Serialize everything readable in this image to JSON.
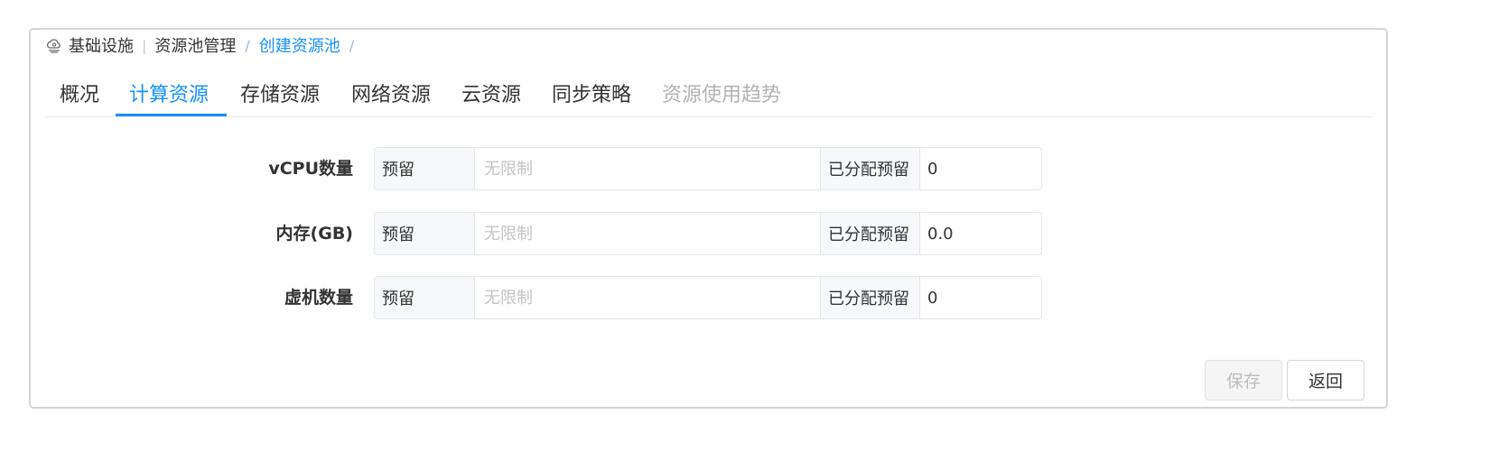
{
  "breadcrumb": {
    "icon": "cloud-icon",
    "items": [
      "基础设施",
      "资源池管理"
    ],
    "current": "创建资源池",
    "separator": "/"
  },
  "tabs": [
    {
      "label": "概况",
      "state": "normal"
    },
    {
      "label": "计算资源",
      "state": "active"
    },
    {
      "label": "存储资源",
      "state": "normal"
    },
    {
      "label": "网络资源",
      "state": "normal"
    },
    {
      "label": "云资源",
      "state": "normal"
    },
    {
      "label": "同步策略",
      "state": "normal"
    },
    {
      "label": "资源使用趋势",
      "state": "disabled"
    }
  ],
  "form": {
    "rows": [
      {
        "label": "vCPU数量",
        "reserve_label": "预留",
        "placeholder": "无限制",
        "value": "",
        "allocated_label": "已分配预留",
        "allocated_value": "0"
      },
      {
        "label": "内存(GB)",
        "reserve_label": "预留",
        "placeholder": "无限制",
        "value": "",
        "allocated_label": "已分配预留",
        "allocated_value": "0.0"
      },
      {
        "label": "虚机数量",
        "reserve_label": "预留",
        "placeholder": "无限制",
        "value": "",
        "allocated_label": "已分配预留",
        "allocated_value": "0"
      }
    ]
  },
  "buttons": {
    "save": {
      "label": "保存",
      "disabled": true
    },
    "back": {
      "label": "返回"
    }
  },
  "colors": {
    "accent": "#1890ff",
    "disabled_text": "#b3b3b3",
    "border": "#d4d4d4"
  }
}
